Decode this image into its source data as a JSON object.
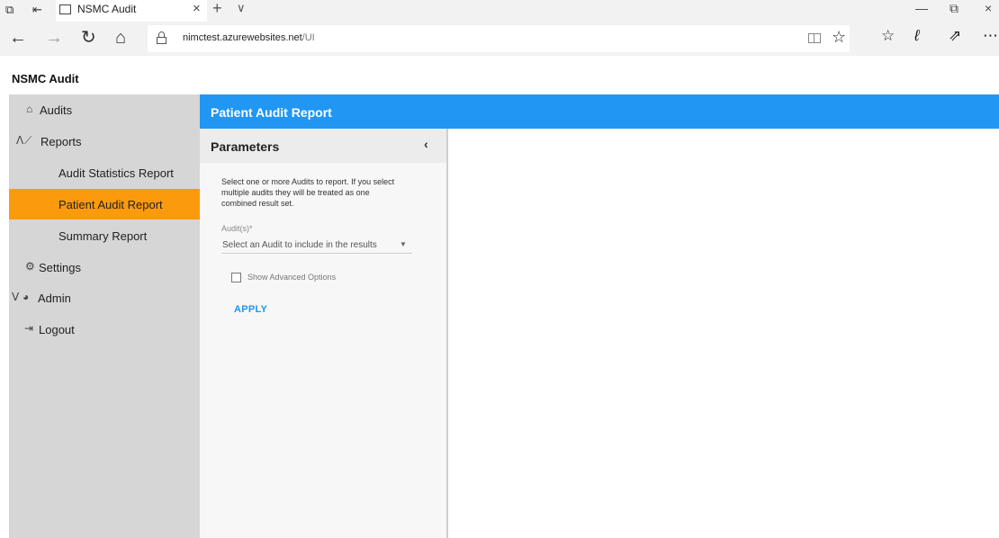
{
  "browser": {
    "tab_title": "NSMC Audit",
    "url_host": "nimctest.azurewebsites.net",
    "url_path": "/UI"
  },
  "app": {
    "title": "NSMC Audit"
  },
  "sidebar": {
    "items": [
      {
        "label": "Audits",
        "icon": "home-icon",
        "active": false
      },
      {
        "label": "Reports",
        "icon": "chart-line-icon",
        "expanded": true
      },
      {
        "label": "Audit Statistics Report",
        "active": false
      },
      {
        "label": "Patient Audit Report",
        "active": true
      },
      {
        "label": "Summary Report",
        "active": false
      },
      {
        "label": "Settings",
        "icon": "gears-icon"
      },
      {
        "label": "Admin",
        "icon": "dashboard-icon",
        "expanded": true
      },
      {
        "label": "Logout",
        "icon": "sign-out-icon"
      }
    ]
  },
  "main": {
    "title": "Patient Audit Report",
    "parameters": {
      "title": "Parameters",
      "collapse_label": "‹",
      "description": "Select one or more Audits to report. If you select multiple audits they will be treated as one combined result set.",
      "audit_label": "Audit(s)*",
      "audit_placeholder": "Select an Audit to include in the results",
      "advanced_label": "Show Advanced Options",
      "advanced_checked": false,
      "apply_label": "APPLY"
    }
  },
  "colors": {
    "accent_blue": "#2196f3",
    "active_orange": "#fc9a0e",
    "sidebar_bg": "#d6d6d6"
  }
}
